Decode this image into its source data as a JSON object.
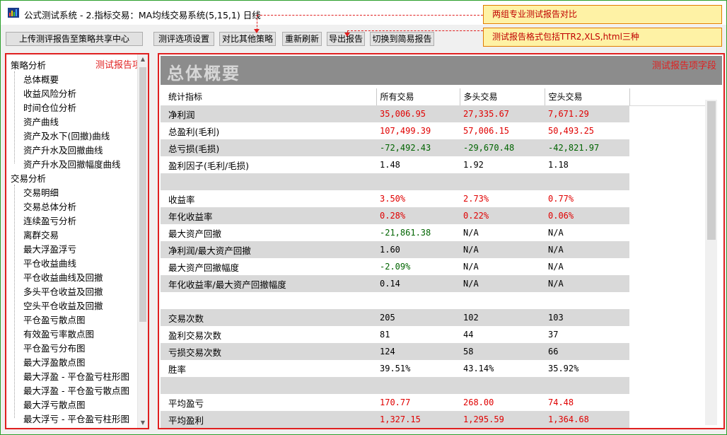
{
  "window": {
    "title": "公式测试系统 - 2.指标交易：MA均线交易系统(5,15,1) 日线"
  },
  "toolbar": {
    "upload_label": "上传测评报告至策略共享中心",
    "options_label": "测评选项设置",
    "compare_label": "对比其他策略",
    "refresh_label": "重新刷新",
    "export_label": "导出报告",
    "switch_label": "切换到简易报告"
  },
  "callouts": {
    "compare_note": "两组专业测试报告对比",
    "format_note": "测试报告格式包括TTR2,XLS,html三种"
  },
  "tree": {
    "overlay_label": "测试报告项",
    "sections": [
      {
        "label": "策略分析",
        "items": [
          "总体概要",
          "收益风险分析",
          "时间仓位分析",
          "资产曲线",
          "资产及水下(回撤)曲线",
          "资产升水及回撤曲线",
          "资产升水及回撤幅度曲线"
        ]
      },
      {
        "label": "交易分析",
        "items": [
          "交易明细",
          "交易总体分析",
          "连续盈亏分析",
          "离群交易",
          "最大浮盈浮亏",
          "平仓收益曲线",
          "平仓收益曲线及回撤",
          "多头平仓收益及回撤",
          "空头平仓收益及回撤",
          "平仓盈亏散点图",
          "有效盈亏率散点图",
          "平仓盈亏分布图",
          "最大浮盈散点图",
          "最大浮盈 - 平仓盈亏柱形图",
          "最大浮盈 - 平仓盈亏散点图",
          "最大浮亏散点图",
          "最大浮亏 - 平仓盈亏柱形图"
        ]
      }
    ]
  },
  "report": {
    "title": "总体概要",
    "field_label": "测试报告项字段",
    "columns": [
      "统计指标",
      "所有交易",
      "多头交易",
      "空头交易"
    ],
    "rows": [
      {
        "label": "净利润",
        "all": "35,006.95",
        "long": "27,335.67",
        "short": "7,671.29",
        "color": "red"
      },
      {
        "label": "总盈利(毛利)",
        "all": "107,499.39",
        "long": "57,006.15",
        "short": "50,493.25",
        "color": "red"
      },
      {
        "label": "总亏损(毛损)",
        "all": "-72,492.43",
        "long": "-29,670.48",
        "short": "-42,821.97",
        "color": "green"
      },
      {
        "label": "盈利因子(毛利/毛损)",
        "all": "1.48",
        "long": "1.92",
        "short": "1.18",
        "color": "black"
      },
      {
        "label": "",
        "all": "",
        "long": "",
        "short": "",
        "color": "black"
      },
      {
        "label": "收益率",
        "all": "3.50%",
        "long": "2.73%",
        "short": "0.77%",
        "color": "red"
      },
      {
        "label": "年化收益率",
        "all": "0.28%",
        "long": "0.22%",
        "short": "0.06%",
        "color": "red"
      },
      {
        "label": "最大资产回撤",
        "all": "-21,861.38",
        "long": "N/A",
        "short": "N/A",
        "color": "mixed-green"
      },
      {
        "label": "净利润/最大资产回撤",
        "all": "1.60",
        "long": "N/A",
        "short": "N/A",
        "color": "black"
      },
      {
        "label": "最大资产回撤幅度",
        "all": "-2.09%",
        "long": "N/A",
        "short": "N/A",
        "color": "mixed-green"
      },
      {
        "label": "年化收益率/最大资产回撤幅度",
        "all": "0.14",
        "long": "N/A",
        "short": "N/A",
        "color": "black"
      },
      {
        "label": "",
        "all": "",
        "long": "",
        "short": "",
        "color": "black"
      },
      {
        "label": "交易次数",
        "all": "205",
        "long": "102",
        "short": "103",
        "color": "black"
      },
      {
        "label": "盈利交易次数",
        "all": "81",
        "long": "44",
        "short": "37",
        "color": "black"
      },
      {
        "label": "亏损交易次数",
        "all": "124",
        "long": "58",
        "short": "66",
        "color": "black"
      },
      {
        "label": "胜率",
        "all": "39.51%",
        "long": "43.14%",
        "short": "35.92%",
        "color": "black"
      },
      {
        "label": "",
        "all": "",
        "long": "",
        "short": "",
        "color": "black"
      },
      {
        "label": "平均盈亏",
        "all": "170.77",
        "long": "268.00",
        "short": "74.48",
        "color": "red"
      },
      {
        "label": "平均盈利",
        "all": "1,327.15",
        "long": "1,295.59",
        "short": "1,364.68",
        "color": "red"
      }
    ]
  },
  "colors": {
    "highlight_border": "#e02020",
    "positive": "#e00000",
    "negative": "#006400",
    "row_shade": "#d9d9d9",
    "banner": "#8c8c8c"
  }
}
